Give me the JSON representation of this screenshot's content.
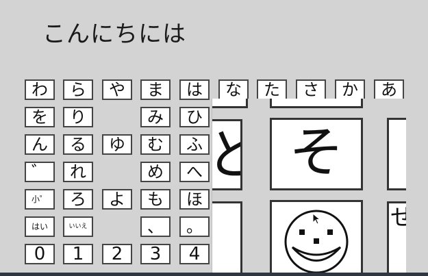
{
  "title": "こんにちには",
  "grid": {
    "rows": [
      [
        "わ",
        "ら",
        "や",
        "ま",
        "は",
        "な",
        "た",
        "さ",
        "か",
        "あ"
      ],
      [
        "を",
        "り",
        "",
        "み",
        "ひ"
      ],
      [
        "ん",
        "る",
        "ゆ",
        "む",
        "ふ"
      ],
      [
        "゛",
        "れ",
        "",
        "め",
        "へ"
      ],
      [
        "小゜",
        "ろ",
        "よ",
        "も",
        "ほ"
      ],
      [
        "はい",
        "いいえ",
        "",
        "、",
        "。"
      ],
      [
        "0",
        "1",
        "2",
        "3",
        "4"
      ]
    ]
  },
  "zoom": {
    "big_char": "そ",
    "partial_char_left": "と",
    "partial_char_right": "せ",
    "icon": "smiley-face-icon"
  },
  "colors": {
    "background": "#d3d3d3",
    "cell_bg": "#ffffff",
    "cell_border": "#444444"
  }
}
